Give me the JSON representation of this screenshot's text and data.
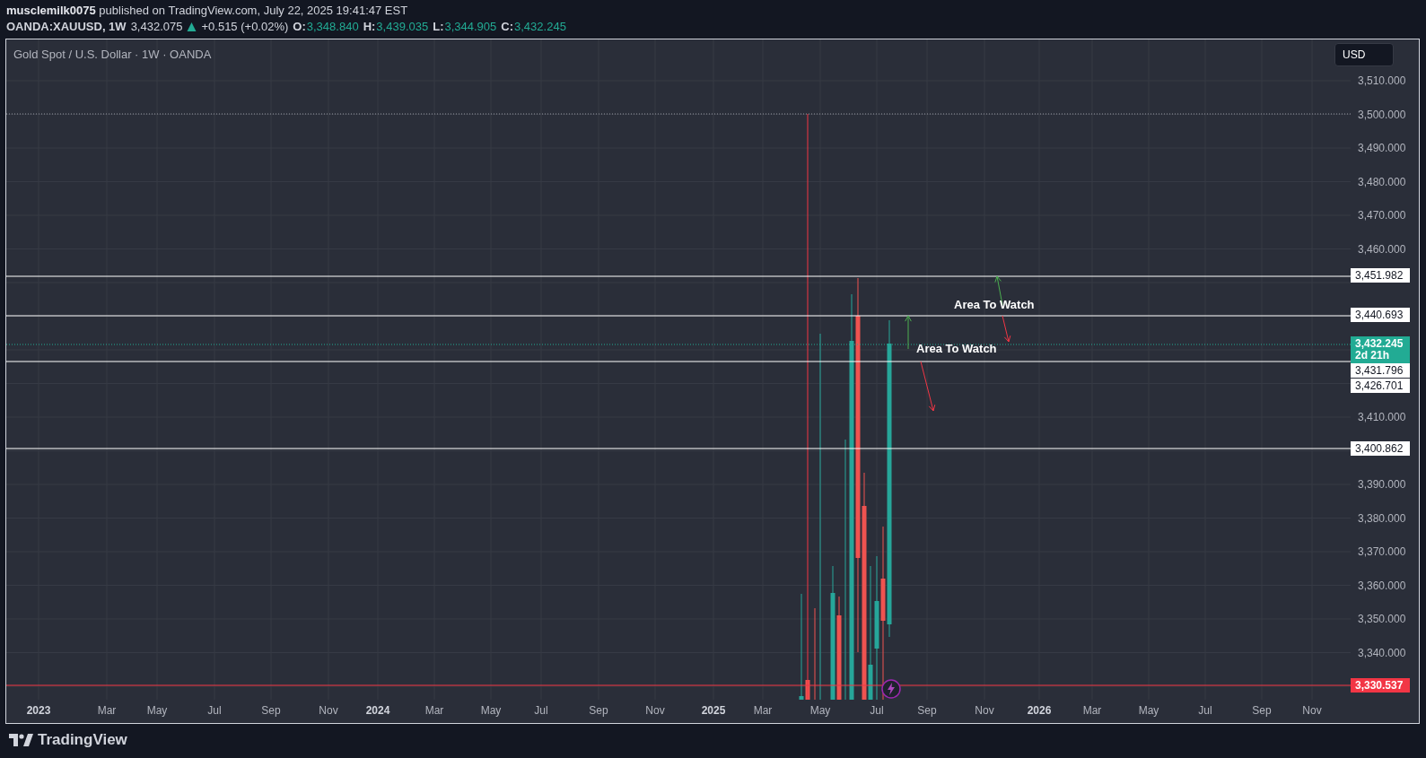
{
  "header": {
    "publisher_line": "**musclemilk0075** published on TradingView.com, July 22, 2025 19:41:47 EST",
    "symbol": "OANDA:XAUUSD, 1W",
    "last": "3,432.075",
    "rising": true,
    "change": "+0.515 (+0.02%)",
    "ohlc": [
      {
        "label": "O:",
        "value": "3,348.840"
      },
      {
        "label": "H:",
        "value": "3,439.035"
      },
      {
        "label": "L:",
        "value": "3,344.905"
      },
      {
        "label": "C:",
        "value": "3,432.245"
      }
    ]
  },
  "chart": {
    "legend": "Gold Spot / U.S. Dollar · 1W · OANDA",
    "currency_button": "USD",
    "price_ticks": [
      "3,510.000",
      "3,500.000",
      "3,490.000",
      "3,480.000",
      "3,470.000",
      "3,460.000",
      "3,410.000",
      "3,390.000",
      "3,380.000",
      "3,370.000",
      "3,360.000",
      "3,350.000",
      "3,340.000"
    ],
    "level_lines": [
      {
        "label": "3,451.982",
        "color": "#ffffff"
      },
      {
        "label": "3,440.693",
        "color": "#ffffff"
      },
      {
        "label": "3,431.796",
        "color": "#ffffff"
      },
      {
        "label": "3,426.701",
        "color": "#ffffff"
      },
      {
        "label": "3,400.862",
        "color": "#ffffff"
      },
      {
        "label": "3,330.537",
        "color": "#f23645"
      }
    ],
    "current_price": {
      "price": "3,432.245",
      "countdown": "2d 21h"
    },
    "annotations": [
      "Area To Watch",
      "Area To Watch"
    ],
    "time_ticks": [
      {
        "label": "2023",
        "kind": "year"
      },
      {
        "label": "Mar",
        "kind": "month"
      },
      {
        "label": "May",
        "kind": "month"
      },
      {
        "label": "Jul",
        "kind": "month"
      },
      {
        "label": "Sep",
        "kind": "month"
      },
      {
        "label": "Nov",
        "kind": "month"
      },
      {
        "label": "2024",
        "kind": "year"
      },
      {
        "label": "Mar",
        "kind": "month"
      },
      {
        "label": "May",
        "kind": "month"
      },
      {
        "label": "Jul",
        "kind": "month"
      },
      {
        "label": "Sep",
        "kind": "month"
      },
      {
        "label": "Nov",
        "kind": "month"
      },
      {
        "label": "2025",
        "kind": "year"
      },
      {
        "label": "Mar",
        "kind": "month"
      },
      {
        "label": "May",
        "kind": "month"
      },
      {
        "label": "Jul",
        "kind": "month"
      },
      {
        "label": "Sep",
        "kind": "month"
      },
      {
        "label": "Nov",
        "kind": "month"
      },
      {
        "label": "2026",
        "kind": "year"
      },
      {
        "label": "Mar",
        "kind": "month"
      },
      {
        "label": "May",
        "kind": "month"
      },
      {
        "label": "Jul",
        "kind": "month"
      },
      {
        "label": "Sep",
        "kind": "month"
      },
      {
        "label": "Nov",
        "kind": "month"
      }
    ]
  },
  "footer": {
    "brand": "TradingView"
  }
}
